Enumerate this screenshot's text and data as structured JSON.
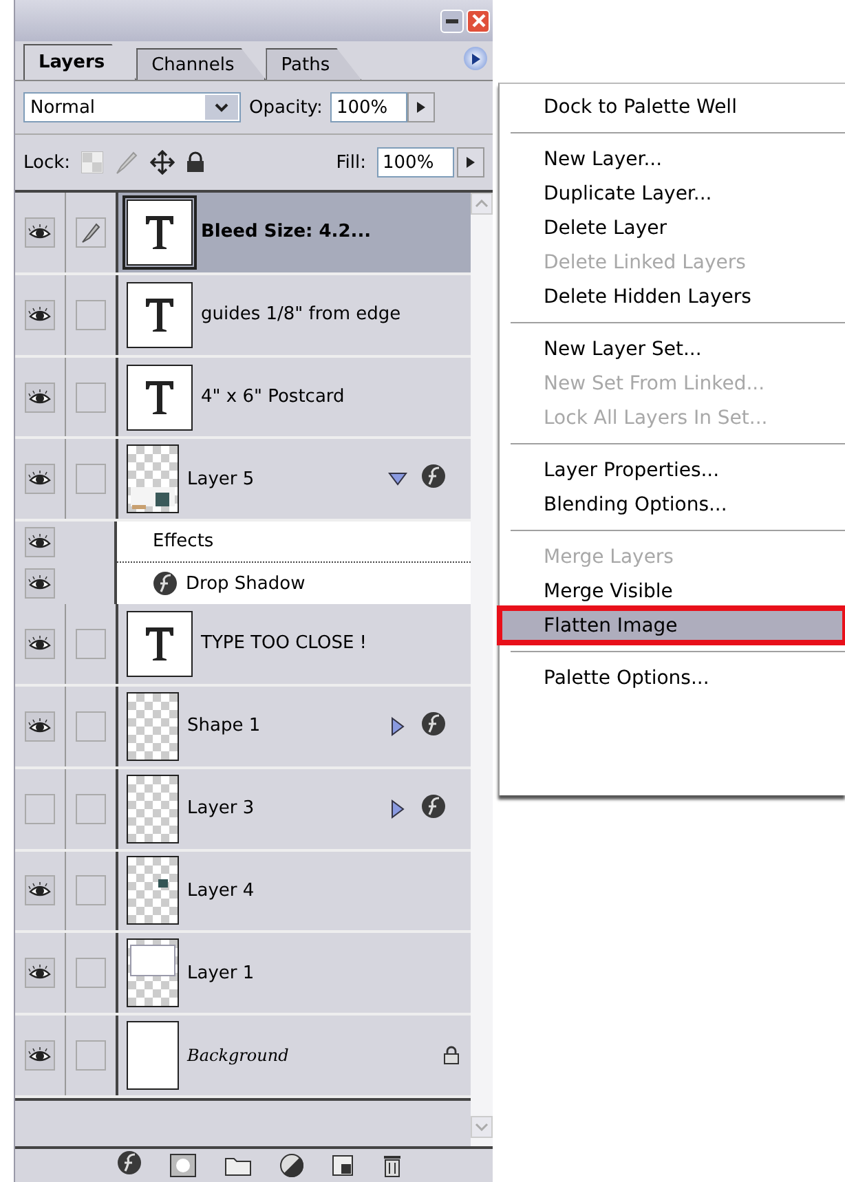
{
  "tabs": [
    {
      "label": "Layers",
      "selected": true
    },
    {
      "label": "Channels",
      "selected": false
    },
    {
      "label": "Paths",
      "selected": false
    }
  ],
  "blend_mode": {
    "value": "Normal"
  },
  "opacity": {
    "label": "Opacity:",
    "value": "100%"
  },
  "lock": {
    "label": "Lock:"
  },
  "fill": {
    "label": "Fill:",
    "value": "100%"
  },
  "layers": [
    {
      "kind": "text",
      "name": "Bleed Size: 4.2...",
      "visible": true,
      "selected": true
    },
    {
      "kind": "text",
      "name": "guides 1/8\" from edge",
      "visible": true,
      "selected": false
    },
    {
      "kind": "text",
      "name": "4\" x 6\" Postcard",
      "visible": true,
      "selected": false
    },
    {
      "kind": "layer",
      "thumbnail": {
        "kind": "photo"
      },
      "name": "Layer 5",
      "visible": true,
      "selected": false,
      "expanded": true,
      "children": [
        {
          "kind": "effects",
          "name": "Effects",
          "visible": true
        },
        {
          "kind": "effect",
          "name": "Drop Shadow",
          "visible": true
        }
      ]
    },
    {
      "kind": "text",
      "name": "TYPE TOO CLOSE !",
      "visible": true,
      "selected": false
    },
    {
      "kind": "layer",
      "thumbnail": {
        "kind": "transparent"
      },
      "name": "Shape 1",
      "visible": true,
      "selected": false,
      "expanded": false
    },
    {
      "kind": "layer",
      "thumbnail": {
        "kind": "transparent"
      },
      "name": "Layer 3",
      "visible": false,
      "selected": false,
      "expanded": false
    },
    {
      "kind": "layer",
      "thumbnail": {
        "kind": "spot"
      },
      "name": "Layer 4",
      "visible": true,
      "selected": false
    },
    {
      "kind": "layer",
      "thumbnail": {
        "kind": "frame"
      },
      "name": "Layer 1",
      "visible": true,
      "selected": false
    },
    {
      "kind": "background",
      "thumbnail": {
        "kind": "white"
      },
      "name": "Background",
      "visible": true,
      "selected": false,
      "locked": true
    }
  ],
  "menu": {
    "groups": [
      [
        {
          "label": "Dock to Palette Well",
          "disabled": false,
          "selected": false
        }
      ],
      [
        {
          "label": "New Layer...",
          "disabled": false,
          "selected": false
        },
        {
          "label": "Duplicate Layer...",
          "disabled": false,
          "selected": false
        },
        {
          "label": "Delete Layer",
          "disabled": false,
          "selected": false
        },
        {
          "label": "Delete Linked Layers",
          "disabled": true,
          "selected": false
        },
        {
          "label": "Delete Hidden Layers",
          "disabled": false,
          "selected": false
        }
      ],
      [
        {
          "label": "New Layer Set...",
          "disabled": false,
          "selected": false
        },
        {
          "label": "New Set From Linked...",
          "disabled": true,
          "selected": false
        },
        {
          "label": "Lock All Layers In Set...",
          "disabled": true,
          "selected": false
        }
      ],
      [
        {
          "label": "Layer Properties...",
          "disabled": false,
          "selected": false
        },
        {
          "label": "Blending Options...",
          "disabled": false,
          "selected": false
        }
      ],
      [
        {
          "label": "Merge Layers",
          "disabled": true,
          "selected": false
        },
        {
          "label": "Merge Visible",
          "disabled": false,
          "selected": false
        },
        {
          "label": "Flatten Image",
          "disabled": false,
          "selected": true
        }
      ],
      [
        {
          "label": "Palette Options...",
          "disabled": false,
          "selected": false
        }
      ]
    ]
  }
}
